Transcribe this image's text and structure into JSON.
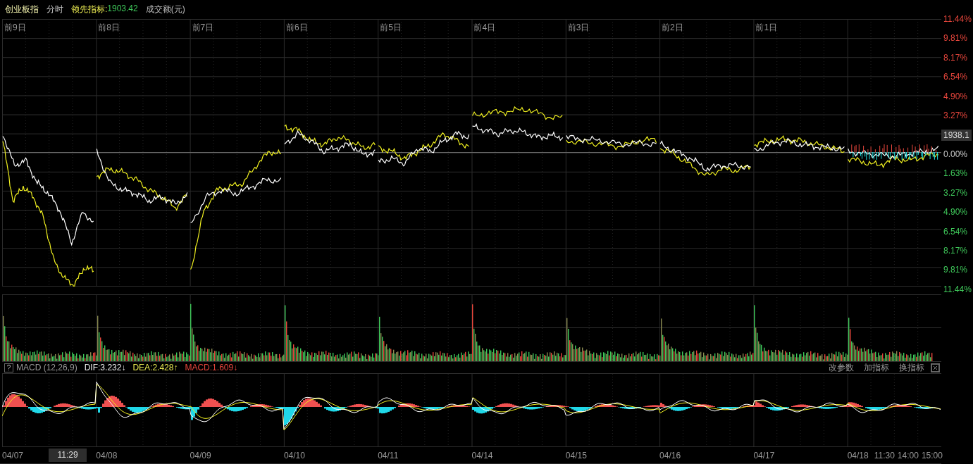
{
  "header": {
    "title": "创业板指",
    "mode": "分时",
    "indicator_label": "领先指标:",
    "indicator_value": "1903.42",
    "volume_label": "成交额(元)"
  },
  "price_chart": {
    "day_labels": [
      "前9日",
      "前8日",
      "前7日",
      "前6日",
      "前5日",
      "前4日",
      "前3日",
      "前2日",
      "前1日"
    ],
    "y_labels": [
      {
        "text": "11.44%",
        "kind": "up"
      },
      {
        "text": "9.81%",
        "kind": "up"
      },
      {
        "text": "8.17%",
        "kind": "up"
      },
      {
        "text": "6.54%",
        "kind": "up"
      },
      {
        "text": "4.90%",
        "kind": "up"
      },
      {
        "text": "3.27%",
        "kind": "up"
      },
      {
        "text": "1938.1",
        "kind": "tag"
      },
      {
        "text": "0.00%",
        "kind": "flat"
      },
      {
        "text": "1.63%",
        "kind": "down"
      },
      {
        "text": "3.27%",
        "kind": "down"
      },
      {
        "text": "4.90%",
        "kind": "down"
      },
      {
        "text": "6.54%",
        "kind": "down"
      },
      {
        "text": "8.17%",
        "kind": "down"
      },
      {
        "text": "9.81%",
        "kind": "down"
      },
      {
        "text": "11.44%",
        "kind": "down"
      }
    ]
  },
  "macd_bar": {
    "help": "?",
    "name": "MACD (12,26,9)",
    "values": [
      {
        "text": "DIF:3.232",
        "arrow": "↓",
        "kind": "dif"
      },
      {
        "text": "DEA:2.428",
        "arrow": "↑",
        "kind": "dea"
      },
      {
        "text": "MACD:1.609",
        "arrow": "↓",
        "kind": "macd"
      }
    ],
    "buttons": [
      "改参数",
      "加指标",
      "换指标"
    ]
  },
  "time_axis": [
    {
      "text": "04/07",
      "kind": "date"
    },
    {
      "text": "11:29",
      "kind": "cursor"
    },
    {
      "text": "04/08",
      "kind": "date"
    },
    {
      "text": "04/09",
      "kind": "date"
    },
    {
      "text": "04/10",
      "kind": "date"
    },
    {
      "text": "04/11",
      "kind": "date"
    },
    {
      "text": "04/14",
      "kind": "date"
    },
    {
      "text": "04/15",
      "kind": "date"
    },
    {
      "text": "04/16",
      "kind": "date"
    },
    {
      "text": "04/17",
      "kind": "date"
    },
    {
      "text": "04/18",
      "kind": "date"
    },
    {
      "text": "11:30",
      "kind": "time"
    },
    {
      "text": "14:00",
      "kind": "time"
    },
    {
      "text": "15:00",
      "kind": "time"
    }
  ]
}
